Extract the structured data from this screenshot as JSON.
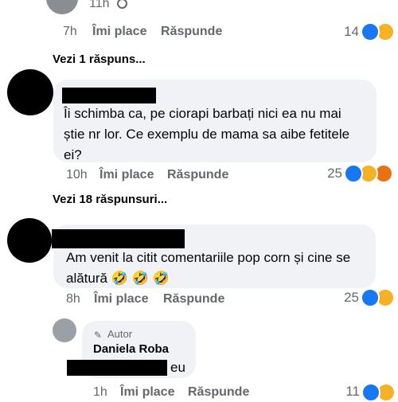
{
  "top": {
    "time": "11h",
    "globe_icon": "globe-icon"
  },
  "comment0": {
    "time": "7h",
    "like": "Îmi place",
    "reply": "Răspunde",
    "count": "14"
  },
  "replies1": "Vezi 1 răspuns...",
  "comment1": {
    "lines": [
      "Îi schimba ca, pe ciorapi barbați nici ea nu mai",
      "știe  nr lor. Ce exemplu de mama sa aibe fetitele",
      "ei?"
    ],
    "time": "10h",
    "like": "Îmi place",
    "reply": "Răspunde",
    "count": "25"
  },
  "replies2": "Vezi 18 răspunsuri...",
  "comment2": {
    "lines": [
      "Am venit la citit comentariile pop corn și cine se",
      "alătură"
    ],
    "emoji": "🤣 🤣 🤣",
    "time": "8h",
    "like": "Îmi place",
    "reply": "Răspunde",
    "count": "25"
  },
  "comment3": {
    "badge": "Autor",
    "author": "Daniela Roba",
    "text": "eu",
    "time": "1h",
    "like": "Îmi place",
    "reply": "Răspunde",
    "count": "11"
  },
  "colors": {
    "like": "#1877f2",
    "haha": "#f7b125",
    "angry": "#e9710f",
    "bubble": "#f0f2f5"
  }
}
